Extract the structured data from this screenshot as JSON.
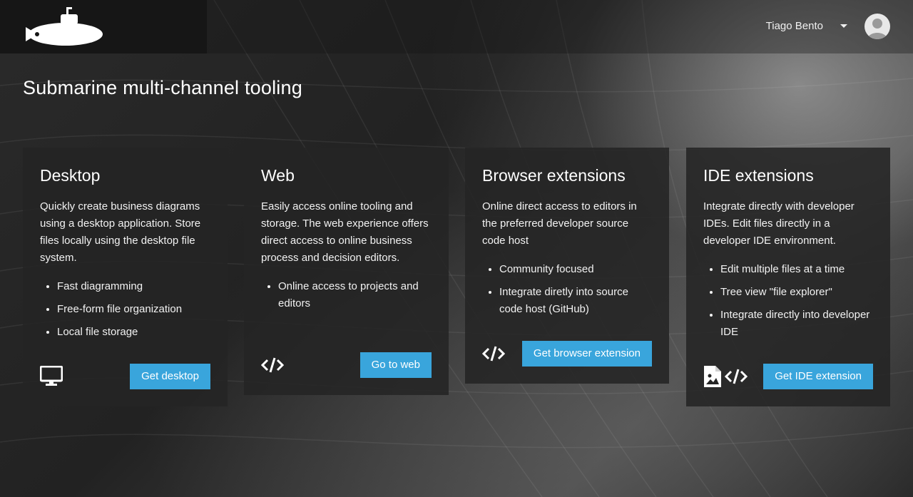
{
  "header": {
    "user_name": "Tiago Bento"
  },
  "page": {
    "title": "Submarine multi-channel tooling"
  },
  "cards": [
    {
      "title": "Desktop",
      "description": "Quickly create business diagrams using a desktop application. Store files locally using the desktop file system.",
      "features": [
        "Fast diagramming",
        "Free-form file organization",
        "Local file storage"
      ],
      "button": "Get desktop",
      "icons": [
        "desktop-icon"
      ]
    },
    {
      "title": "Web",
      "description": "Easily access online tooling and storage. The web experience offers direct access to online business process and decision editors.",
      "features": [
        "Online access to projects and editors"
      ],
      "button": "Go to web",
      "icons": [
        "code-icon"
      ]
    },
    {
      "title": "Browser extensions",
      "description": "Online direct access to editors in the preferred developer source code host",
      "features": [
        "Community focused",
        "Integrate diretly into source code host (GitHub)"
      ],
      "button": "Get browser extension",
      "icons": [
        "code-icon"
      ]
    },
    {
      "title": "IDE extensions",
      "description": "Integrate directly with developer IDEs. Edit files directly in a developer IDE environment.",
      "features": [
        "Edit multiple files at a time",
        "Tree view \"file explorer\"",
        "Integrate directly into developer IDE"
      ],
      "button": "Get IDE extension",
      "icons": [
        "image-file-icon",
        "code-icon"
      ]
    }
  ],
  "colors": {
    "accent": "#39a5dc",
    "card_bg": "#242424",
    "logo_bg": "#161616"
  }
}
